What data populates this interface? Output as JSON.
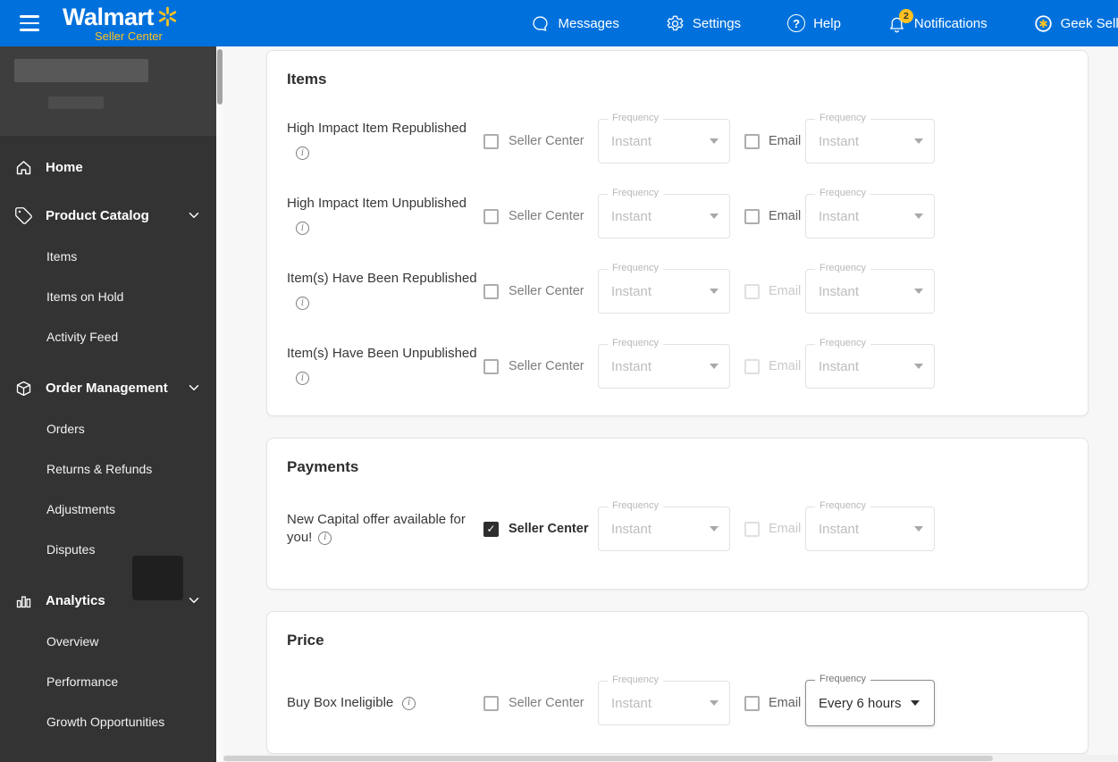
{
  "topbar": {
    "brand": "Walmart",
    "brand_sub": "Seller Center",
    "nav": [
      {
        "label": "Messages",
        "icon": "message-bubble-icon"
      },
      {
        "label": "Settings",
        "icon": "gear-icon"
      },
      {
        "label": "Help",
        "icon": "question-circle-icon"
      },
      {
        "label": "Notifications",
        "icon": "bell-icon",
        "badge": "2"
      },
      {
        "label": "Geek Seller",
        "icon": "spark-badge-icon"
      }
    ]
  },
  "sidebar": {
    "items": [
      {
        "label": "Home",
        "icon": "home-icon"
      },
      {
        "label": "Product Catalog",
        "icon": "tag-icon",
        "expanded": true,
        "children": [
          {
            "label": "Items"
          },
          {
            "label": "Items on Hold"
          },
          {
            "label": "Activity Feed"
          }
        ]
      },
      {
        "label": "Order Management",
        "icon": "package-box-icon",
        "expanded": true,
        "children": [
          {
            "label": "Orders"
          },
          {
            "label": "Returns & Refunds"
          },
          {
            "label": "Adjustments"
          },
          {
            "label": "Disputes"
          }
        ]
      },
      {
        "label": "Analytics",
        "icon": "bar-chart-icon",
        "expanded": true,
        "children": [
          {
            "label": "Overview"
          },
          {
            "label": "Performance"
          },
          {
            "label": "Growth Opportunities"
          }
        ]
      }
    ]
  },
  "labels": {
    "frequency": "Frequency",
    "seller_center": "Seller Center",
    "email": "Email"
  },
  "cards": [
    {
      "title": "Items",
      "rows": [
        {
          "label": "High Impact Item Republished",
          "seller_center_checked": false,
          "freq_seller_center": "Instant",
          "freq_seller_center_enabled": false,
          "email_checked": false,
          "email_disabled": false,
          "freq_email": "Instant",
          "freq_email_enabled": false
        },
        {
          "label": "High Impact Item Unpublished",
          "seller_center_checked": false,
          "freq_seller_center": "Instant",
          "freq_seller_center_enabled": false,
          "email_checked": false,
          "email_disabled": false,
          "freq_email": "Instant",
          "freq_email_enabled": false
        },
        {
          "label": "Item(s) Have Been Republished",
          "seller_center_checked": false,
          "freq_seller_center": "Instant",
          "freq_seller_center_enabled": false,
          "email_checked": false,
          "email_disabled": true,
          "freq_email": "Instant",
          "freq_email_enabled": false
        },
        {
          "label": "Item(s) Have Been Unpublished",
          "seller_center_checked": false,
          "freq_seller_center": "Instant",
          "freq_seller_center_enabled": false,
          "email_checked": false,
          "email_disabled": true,
          "freq_email": "Instant",
          "freq_email_enabled": false
        }
      ]
    },
    {
      "title": "Payments",
      "rows": [
        {
          "label": "New Capital offer available for you!",
          "seller_center_checked": true,
          "freq_seller_center": "Instant",
          "freq_seller_center_enabled": false,
          "email_checked": false,
          "email_disabled": true,
          "freq_email": "Instant",
          "freq_email_enabled": false
        }
      ]
    },
    {
      "title": "Price",
      "rows": [
        {
          "label": "Buy Box Ineligible",
          "seller_center_checked": false,
          "freq_seller_center": "Instant",
          "freq_seller_center_enabled": false,
          "email_checked": false,
          "email_disabled": false,
          "freq_email": "Every 6 hours",
          "freq_email_enabled": true
        }
      ]
    }
  ],
  "colors": {
    "brand_blue": "#0071dc",
    "brand_yellow": "#ffc220",
    "sidebar_bg": "#333333",
    "checkbox_checked": "#2e2e2e"
  }
}
